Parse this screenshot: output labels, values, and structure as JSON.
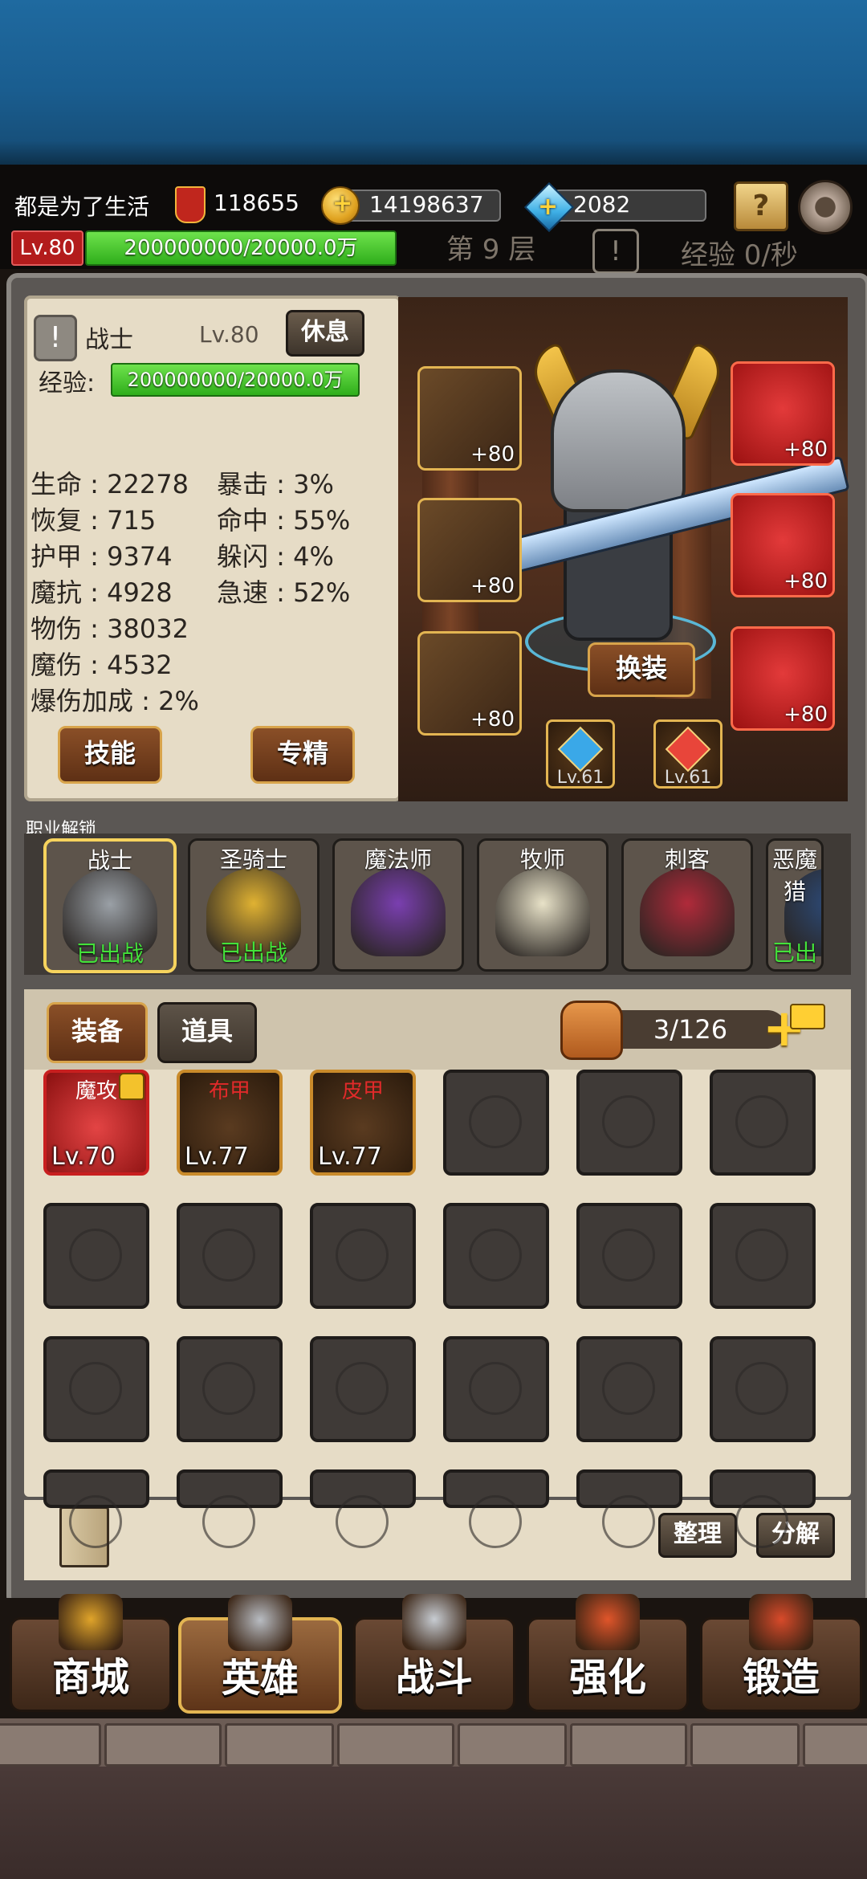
{
  "header": {
    "player_name": "都是为了生活",
    "power": "118655",
    "gold": "14198637",
    "diamonds": "2082",
    "level_badge": "Lv.80",
    "exp_bar": "200000000/20000.0万",
    "floor": "第 9 层",
    "warn_mark": "!",
    "exp_rate": "经验 0/秒",
    "plus": "+"
  },
  "hero_panel": {
    "warn_mark": "!",
    "class_name": "战士",
    "level": "Lv.80",
    "rest_label": "休息",
    "exp_label": "经验:",
    "exp_value": "200000000/20000.0万",
    "stats_left": [
      "生命 : 22278",
      "恢复 : 715",
      "护甲 : 9374",
      "魔抗 : 4928",
      "物伤 : 38032",
      "魔伤 : 4532",
      "爆伤加成 : 2%"
    ],
    "stats_right": [
      "暴击 : 3%",
      "命中 : 55%",
      "躲闪 : 4%",
      "急速 : 52%"
    ],
    "skill_label": "技能",
    "mastery_label": "专精",
    "change_equip_label": "换装"
  },
  "equipment": {
    "left_slots": [
      {
        "icon": "helmet-icon",
        "plus": "+80"
      },
      {
        "icon": "armor-icon",
        "plus": "+80"
      },
      {
        "icon": "boots-icon",
        "plus": "+80"
      }
    ],
    "right_slots": [
      {
        "icon": "bracer-icon",
        "plus": "+80"
      },
      {
        "icon": "sword-icon",
        "plus": "+80"
      },
      {
        "icon": "ring-icon",
        "plus": "+80"
      }
    ],
    "gems": [
      {
        "lv": "Lv.61",
        "color": "#3aa8e8"
      },
      {
        "lv": "Lv.61",
        "color": "#e8453a"
      }
    ]
  },
  "jobs": {
    "section_label": "职业解锁",
    "items": [
      {
        "name": "战士",
        "status": "已出战",
        "color": "#9aa0a6"
      },
      {
        "name": "圣骑士",
        "status": "已出战",
        "color": "#e0b232"
      },
      {
        "name": "魔法师",
        "status": "",
        "color": "#7a3fb0"
      },
      {
        "name": "牧师",
        "status": "",
        "color": "#e8e2c8"
      },
      {
        "name": "刺客",
        "status": "",
        "color": "#b02a3a"
      },
      {
        "name": "恶魔猎",
        "status": "已出",
        "color": "#2c4b7a"
      }
    ]
  },
  "bag": {
    "tab_equip": "装备",
    "tab_items": "道具",
    "capacity": "3/126",
    "plus": "+",
    "items": [
      {
        "tag": "魔攻",
        "lv": "Lv.70",
        "rarity": "#c81f1f",
        "tag_color": "#ffffff"
      },
      {
        "tag": "布甲",
        "lv": "Lv.77",
        "rarity": "#c98a2a",
        "tag_color": "#e12a2a"
      },
      {
        "tag": "皮甲",
        "lv": "Lv.77",
        "rarity": "#c98a2a",
        "tag_color": "#e12a2a"
      }
    ],
    "sort_label": "整理",
    "decompose_label": "分解"
  },
  "nav": [
    {
      "label": "商城",
      "icon": "treasure-chest-icon"
    },
    {
      "label": "英雄",
      "icon": "knight-helmet-icon",
      "active": true
    },
    {
      "label": "战斗",
      "icon": "crossed-swords-icon"
    },
    {
      "label": "强化",
      "icon": "anvil-hammer-icon"
    },
    {
      "label": "锻造",
      "icon": "forge-icon"
    }
  ]
}
